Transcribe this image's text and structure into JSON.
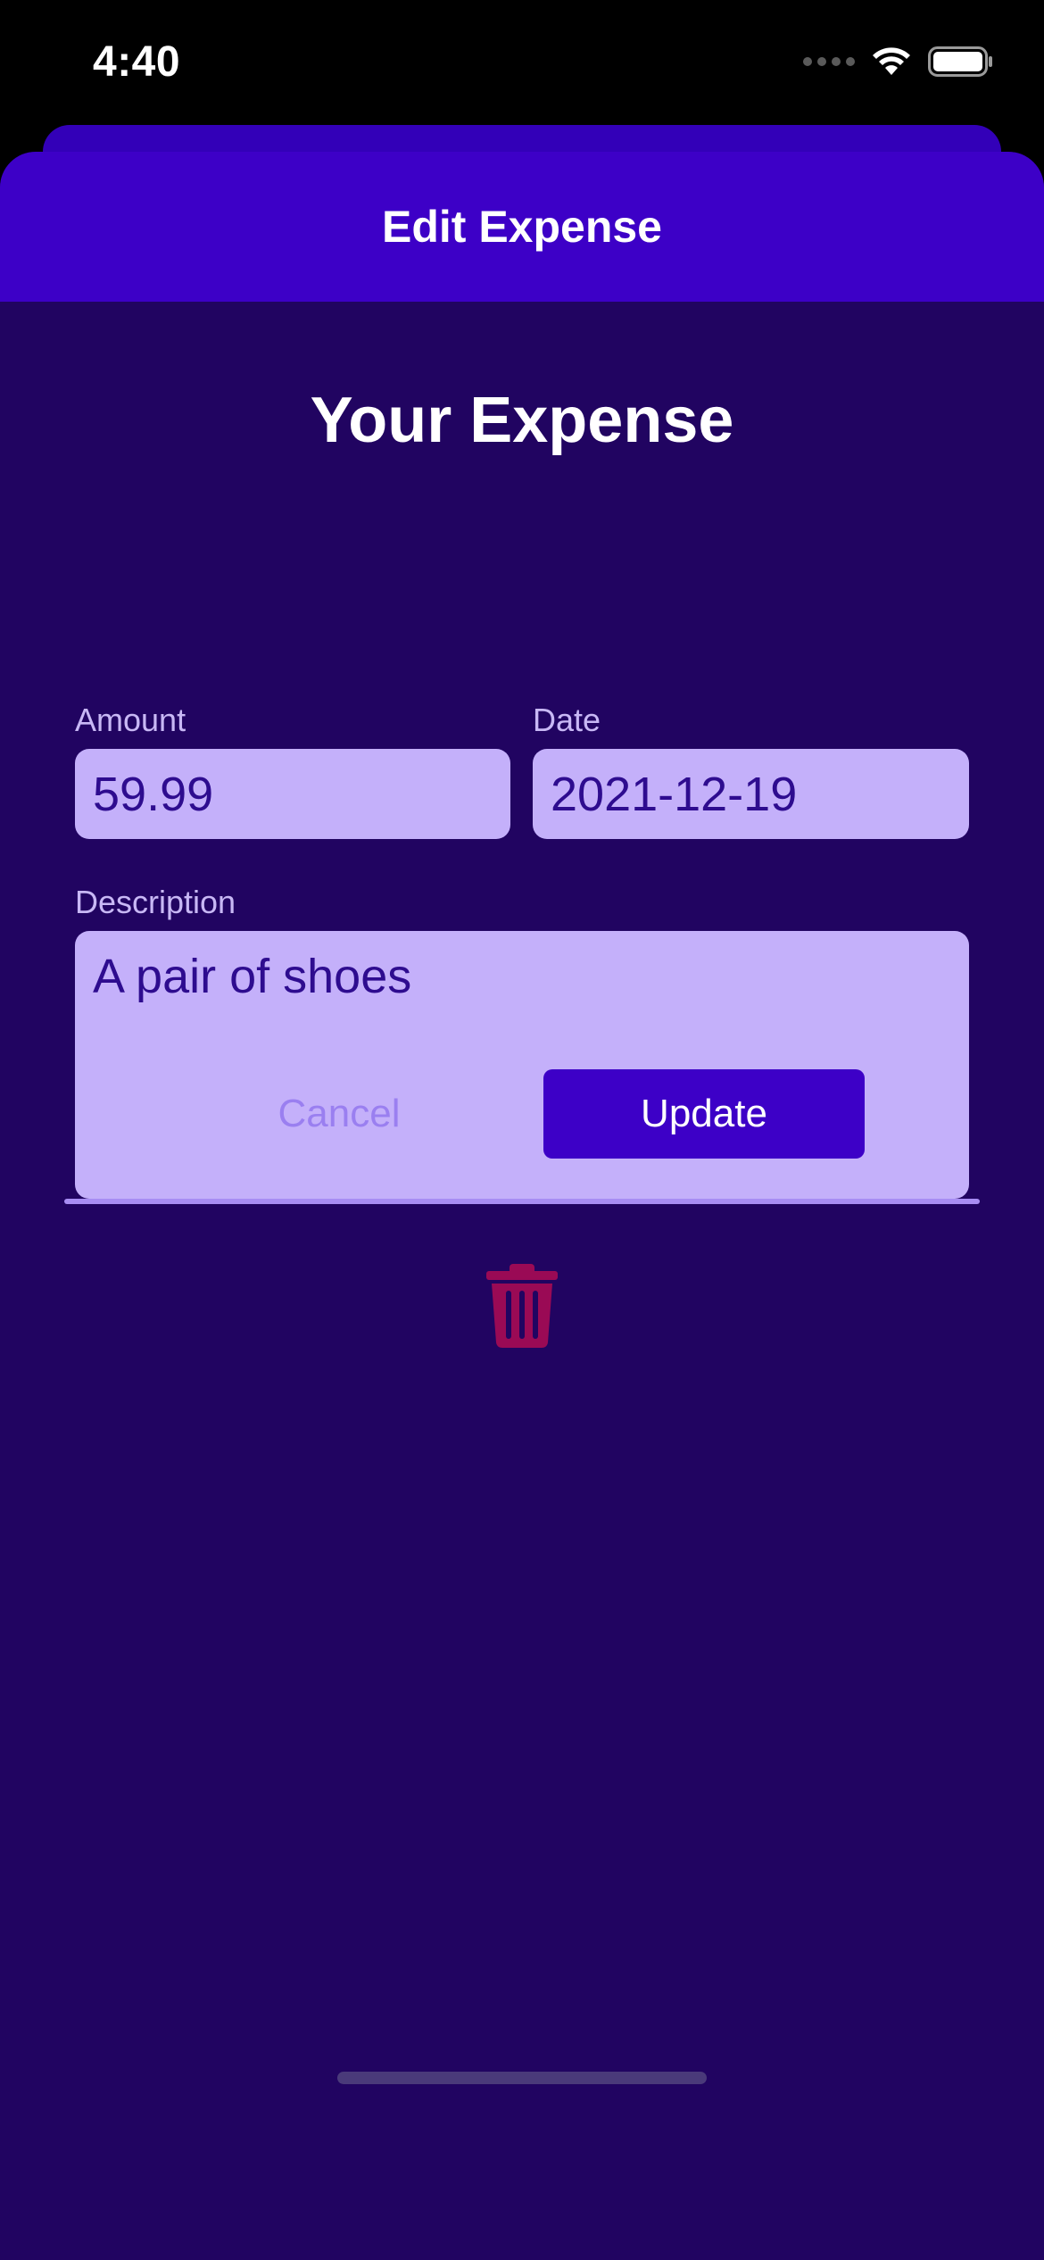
{
  "status_bar": {
    "time": "4:40",
    "icons": [
      "signal-icon",
      "wifi-icon",
      "battery-icon"
    ]
  },
  "sheet": {
    "title": "Edit Expense"
  },
  "form": {
    "heading": "Your Expense",
    "amount": {
      "label": "Amount",
      "value": "59.99"
    },
    "date": {
      "label": "Date",
      "value": "2021-12-19"
    },
    "description": {
      "label": "Description",
      "value": "A pair of shoes"
    }
  },
  "actions": {
    "cancel_label": "Cancel",
    "update_label": "Update",
    "delete_icon": "trash-icon"
  },
  "colors": {
    "background": "#210461",
    "header": "#3d00c7",
    "field": "#c4b0fa",
    "field_text": "#2e0c8f",
    "label": "#c8b8f5",
    "cancel_text": "#9a7ff0",
    "divider": "#a88df3",
    "delete": "#9a0a55"
  }
}
